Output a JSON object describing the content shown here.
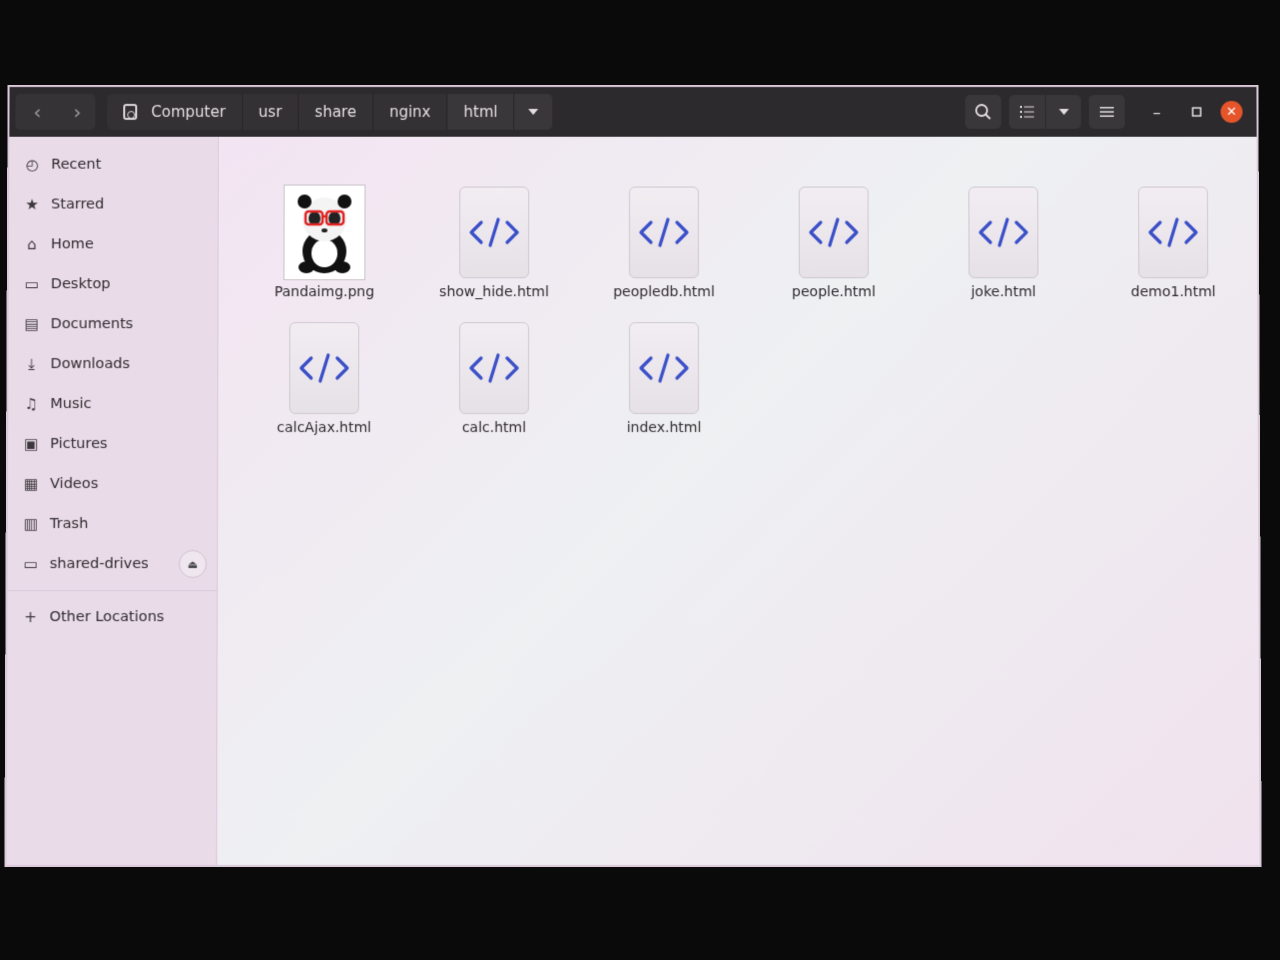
{
  "pathbar": {
    "crumbs": [
      "Computer",
      "usr",
      "share",
      "nginx",
      "html"
    ]
  },
  "sidebar": {
    "items": [
      {
        "label": "Recent",
        "icon": "clock-icon"
      },
      {
        "label": "Starred",
        "icon": "star-icon"
      },
      {
        "label": "Home",
        "icon": "home-icon"
      },
      {
        "label": "Desktop",
        "icon": "desktop-icon"
      },
      {
        "label": "Documents",
        "icon": "documents-icon"
      },
      {
        "label": "Downloads",
        "icon": "downloads-icon"
      },
      {
        "label": "Music",
        "icon": "music-icon"
      },
      {
        "label": "Pictures",
        "icon": "pictures-icon"
      },
      {
        "label": "Videos",
        "icon": "videos-icon"
      },
      {
        "label": "Trash",
        "icon": "trash-icon"
      },
      {
        "label": "shared-drives",
        "icon": "drive-icon"
      }
    ],
    "other_locations": "Other Locations"
  },
  "files": [
    {
      "name": "Pandaimg.png",
      "type": "image"
    },
    {
      "name": "show_hide.html",
      "type": "html"
    },
    {
      "name": "peopledb.html",
      "type": "html"
    },
    {
      "name": "people.html",
      "type": "html"
    },
    {
      "name": "joke.html",
      "type": "html"
    },
    {
      "name": "demo1.html",
      "type": "html"
    },
    {
      "name": "calcAjax.html",
      "type": "html"
    },
    {
      "name": "calc.html",
      "type": "html"
    },
    {
      "name": "index.html",
      "type": "html"
    }
  ],
  "colors": {
    "headerbar": "#2c2a2c",
    "close_button": "#e6552a",
    "code_icon": "#3a4fc8"
  }
}
